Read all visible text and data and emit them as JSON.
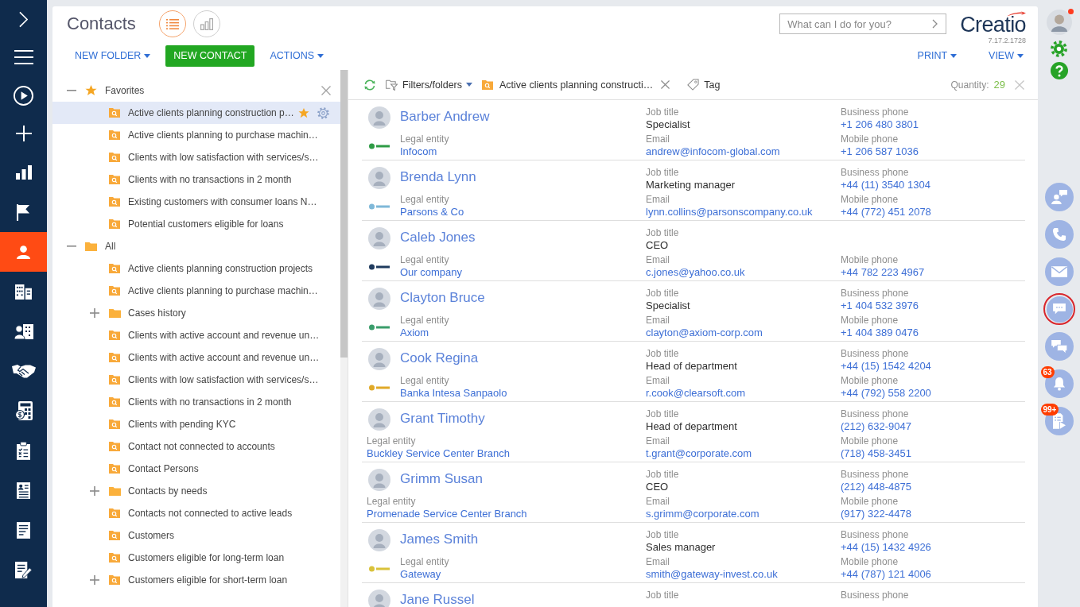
{
  "nav": {
    "items": [
      {
        "kind": "chevron",
        "selected": false
      },
      {
        "kind": "menu",
        "selected": false
      },
      {
        "kind": "play",
        "selected": false
      },
      {
        "kind": "plus",
        "selected": false
      },
      {
        "kind": "chart",
        "selected": false
      },
      {
        "kind": "flag",
        "selected": false
      },
      {
        "kind": "person",
        "selected": true
      },
      {
        "kind": "buildings",
        "selected": false
      },
      {
        "kind": "people",
        "selected": false
      },
      {
        "kind": "handshake",
        "selected": false
      },
      {
        "kind": "calculator",
        "selected": false
      },
      {
        "kind": "checklist",
        "selected": false
      },
      {
        "kind": "card",
        "selected": false
      },
      {
        "kind": "document",
        "selected": false
      },
      {
        "kind": "editdoc",
        "selected": false
      }
    ]
  },
  "header": {
    "title": "Contacts",
    "view_modes": [
      {
        "kind": "list",
        "selected": true
      },
      {
        "kind": "chart",
        "selected": false
      }
    ],
    "search": {
      "placeholder": "What can I do for you?"
    },
    "logo": {
      "text": "Creatio",
      "version": "7.17.2.1728"
    }
  },
  "toolbar": {
    "left": [
      {
        "label": "NEW FOLDER",
        "kind": "dropdown"
      },
      {
        "label": "NEW CONTACT",
        "kind": "primary"
      },
      {
        "label": "ACTIONS",
        "kind": "dropdown"
      }
    ],
    "right": [
      {
        "label": "PRINT",
        "kind": "dropdown"
      },
      {
        "label": "VIEW",
        "kind": "dropdown"
      }
    ]
  },
  "folders": {
    "groups": [
      {
        "label": "Favorites",
        "kind": "favorites",
        "expanded": true,
        "children": [
          {
            "label": "Active clients planning construction p…",
            "kind": "search",
            "expandable": false,
            "selected": true
          },
          {
            "label": "Active clients planning to purchase machin…",
            "kind": "search",
            "expandable": false,
            "selected": false
          },
          {
            "label": "Clients with low satisfaction with services/s…",
            "kind": "search",
            "expandable": false,
            "selected": false
          },
          {
            "label": "Clients with no transactions in 2 month",
            "kind": "search",
            "expandable": false,
            "selected": false
          },
          {
            "label": "Existing customers with consumer loans N…",
            "kind": "search",
            "expandable": false,
            "selected": false
          },
          {
            "label": "Potential customers eligible for loans",
            "kind": "search",
            "expandable": false,
            "selected": false
          }
        ]
      },
      {
        "label": "All",
        "kind": "folder",
        "expanded": true,
        "children": [
          {
            "label": "Active clients planning construction projects",
            "kind": "search",
            "expandable": false,
            "selected": false
          },
          {
            "label": "Active clients planning to purchase machin…",
            "kind": "search",
            "expandable": false,
            "selected": false
          },
          {
            "label": "Cases history",
            "kind": "folder",
            "expandable": true,
            "selected": false
          },
          {
            "label": "Clients with active account and revenue un…",
            "kind": "search",
            "expandable": false,
            "selected": false
          },
          {
            "label": "Clients with active account and revenue un…",
            "kind": "search",
            "expandable": false,
            "selected": false
          },
          {
            "label": "Clients with low satisfaction with services/s…",
            "kind": "search",
            "expandable": false,
            "selected": false
          },
          {
            "label": "Clients with no transactions in 2 month",
            "kind": "search",
            "expandable": false,
            "selected": false
          },
          {
            "label": "Clients with pending KYC",
            "kind": "search",
            "expandable": false,
            "selected": false
          },
          {
            "label": "Contact not connected to accounts",
            "kind": "search",
            "expandable": false,
            "selected": false
          },
          {
            "label": "Contact Persons",
            "kind": "search",
            "expandable": false,
            "selected": false
          },
          {
            "label": "Contacts by needs",
            "kind": "folder",
            "expandable": true,
            "selected": false
          },
          {
            "label": "Contacts not connected to active leads",
            "kind": "search",
            "expandable": false,
            "selected": false
          },
          {
            "label": "Customers",
            "kind": "search",
            "expandable": false,
            "selected": false
          },
          {
            "label": "Customers eligible for long-term loan",
            "kind": "search",
            "expandable": false,
            "selected": false
          },
          {
            "label": "Customers eligible for short-term loan",
            "kind": "search",
            "expandable": true,
            "selected": false
          }
        ]
      }
    ]
  },
  "filter_bar": {
    "filters_label": "Filters/folders",
    "active_filter": "Active clients planning constructi…",
    "tag_label": "Tag",
    "quantity_label": "Quantity:",
    "quantity": "29"
  },
  "contacts": [
    {
      "name": "Barber Andrew",
      "job_title": {
        "label": "Job title",
        "value": "Specialist"
      },
      "business_phone": {
        "label": "Business phone",
        "value": "+1 206 480 3801"
      },
      "logo": {
        "color": "#2e9b45"
      },
      "legal_entity": {
        "label": "Legal entity",
        "value": "Infocom"
      },
      "email": {
        "label": "Email",
        "value": "andrew@infocom-global.com"
      },
      "mobile_phone": {
        "label": "Mobile phone",
        "value": "+1 206 587 1036"
      }
    },
    {
      "name": "Brenda Lynn",
      "job_title": {
        "label": "Job title",
        "value": "Marketing manager"
      },
      "business_phone": {
        "label": "Business phone",
        "value": "+44 (11) 3540 1304"
      },
      "logo": {
        "color": "#7fb8d8"
      },
      "legal_entity": {
        "label": "Legal entity",
        "value": "Parsons & Co"
      },
      "email": {
        "label": "Email",
        "value": "lynn.collins@parsonscompany.co.uk"
      },
      "mobile_phone": {
        "label": "Mobile phone",
        "value": "+44 (772) 451 2078"
      }
    },
    {
      "name": "Caleb Jones",
      "job_title": {
        "label": "Job title",
        "value": "CEO"
      },
      "logo": {
        "color": "#1f3b5e"
      },
      "legal_entity": {
        "label": "Legal entity",
        "value": "Our company"
      },
      "email": {
        "label": "Email",
        "value": "c.jones@yahoo.co.uk"
      },
      "mobile_phone": {
        "label": "Mobile phone",
        "value": "+44 782 223 4967"
      }
    },
    {
      "name": "Clayton Bruce",
      "job_title": {
        "label": "Job title",
        "value": "Specialist"
      },
      "business_phone": {
        "label": "Business phone",
        "value": "+1 404 532 3976"
      },
      "logo": {
        "color": "#3a9d6b"
      },
      "legal_entity": {
        "label": "Legal entity",
        "value": "Axiom"
      },
      "email": {
        "label": "Email",
        "value": "clayton@axiom-corp.com"
      },
      "mobile_phone": {
        "label": "Mobile phone",
        "value": "+1 404 389 0476"
      }
    },
    {
      "name": "Cook Regina",
      "job_title": {
        "label": "Job title",
        "value": "Head of department"
      },
      "business_phone": {
        "label": "Business phone",
        "value": "+44 (15) 1542 4204"
      },
      "logo": {
        "color": "#e0a928"
      },
      "legal_entity": {
        "label": "Legal entity",
        "value": "Banka Intesa Sanpaolo"
      },
      "email": {
        "label": "Email",
        "value": "r.cook@clearsoft.com"
      },
      "mobile_phone": {
        "label": "Mobile phone",
        "value": "+44 (792) 558 2200"
      }
    },
    {
      "name": "Grant Timothy",
      "job_title": {
        "label": "Job title",
        "value": "Head of department"
      },
      "business_phone": {
        "label": "Business phone",
        "value": "(212) 632-9047"
      },
      "legal_entity": {
        "label": "Legal entity",
        "value": "Buckley Service Center Branch"
      },
      "email": {
        "label": "Email",
        "value": "t.grant@corporate.com"
      },
      "mobile_phone": {
        "label": "Mobile phone",
        "value": "(718) 458-3451"
      }
    },
    {
      "name": "Grimm Susan",
      "job_title": {
        "label": "Job title",
        "value": "CEO"
      },
      "business_phone": {
        "label": "Business phone",
        "value": "(212) 448-4875"
      },
      "legal_entity": {
        "label": "Legal entity",
        "value": "Promenade Service Center Branch"
      },
      "email": {
        "label": "Email",
        "value": "s.grimm@corporate.com"
      },
      "mobile_phone": {
        "label": "Mobile phone",
        "value": "(917) 322-4478"
      }
    },
    {
      "name": "James Smith",
      "job_title": {
        "label": "Job title",
        "value": "Sales manager"
      },
      "business_phone": {
        "label": "Business phone",
        "value": "+44 (15) 1432 4926"
      },
      "logo": {
        "color": "#d9c23a"
      },
      "legal_entity": {
        "label": "Legal entity",
        "value": "Gateway"
      },
      "email": {
        "label": "Email",
        "value": "smith@gateway-invest.co.uk"
      },
      "mobile_phone": {
        "label": "Mobile phone",
        "value": "+44 (787) 121 4006"
      }
    },
    {
      "name": "Jane Russel",
      "job_title": {
        "label": "Job title"
      },
      "business_phone": {
        "label": "Business phone"
      }
    }
  ],
  "rail": {
    "user": {
      "notification": true
    },
    "buttons": [
      {
        "kind": "contact",
        "selected": false
      },
      {
        "kind": "call",
        "selected": false
      },
      {
        "kind": "email",
        "selected": false
      },
      {
        "kind": "chat",
        "selected": true
      },
      {
        "kind": "feed",
        "selected": false
      },
      {
        "kind": "bell",
        "selected": false,
        "badge": "63"
      },
      {
        "kind": "process",
        "selected": false,
        "badge": "99+"
      }
    ]
  }
}
